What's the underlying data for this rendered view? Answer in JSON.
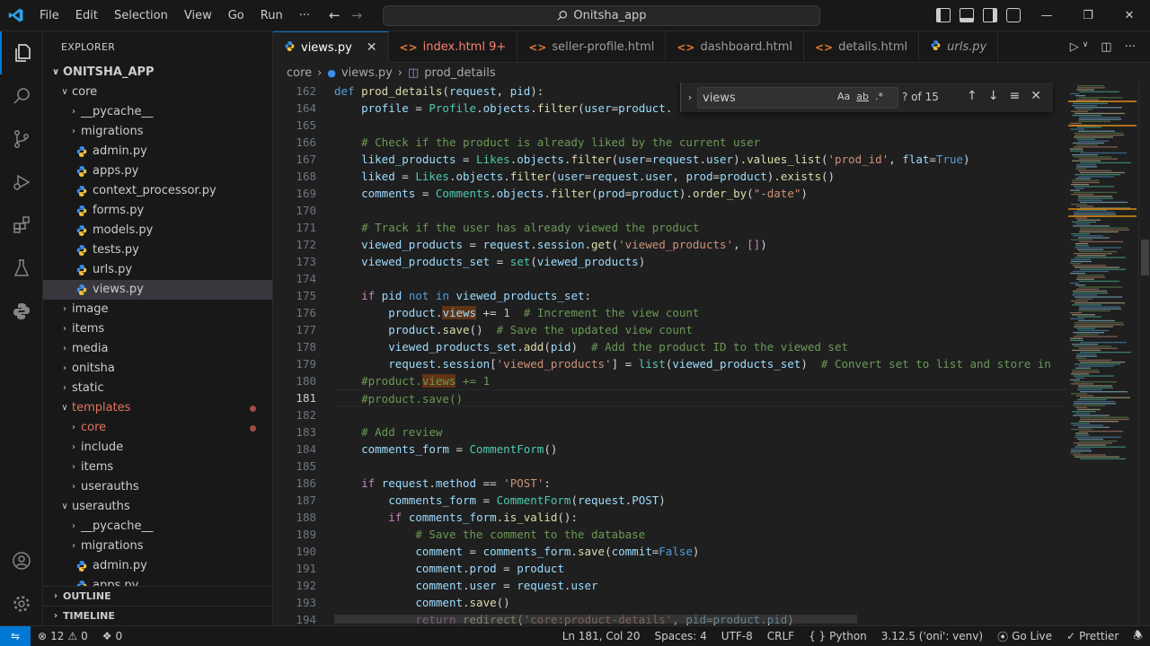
{
  "window": {
    "title": "Onitsha_app",
    "menu": [
      "File",
      "Edit",
      "Selection",
      "View",
      "Go",
      "Run",
      "···"
    ]
  },
  "sidebar": {
    "title": "EXPLORER",
    "root": "ONITSHA_APP",
    "tree": [
      {
        "label": "core",
        "depth": 1,
        "type": "folder-open"
      },
      {
        "label": "__pycache__",
        "depth": 2,
        "type": "folder"
      },
      {
        "label": "migrations",
        "depth": 2,
        "type": "folder"
      },
      {
        "label": "admin.py",
        "depth": 2,
        "type": "file"
      },
      {
        "label": "apps.py",
        "depth": 2,
        "type": "file"
      },
      {
        "label": "context_processor.py",
        "depth": 2,
        "type": "file"
      },
      {
        "label": "forms.py",
        "depth": 2,
        "type": "file"
      },
      {
        "label": "models.py",
        "depth": 2,
        "type": "file"
      },
      {
        "label": "tests.py",
        "depth": 2,
        "type": "file"
      },
      {
        "label": "urls.py",
        "depth": 2,
        "type": "file"
      },
      {
        "label": "views.py",
        "depth": 2,
        "type": "file",
        "selected": true
      },
      {
        "label": "image",
        "depth": 1,
        "type": "folder"
      },
      {
        "label": "items",
        "depth": 1,
        "type": "folder"
      },
      {
        "label": "media",
        "depth": 1,
        "type": "folder"
      },
      {
        "label": "onitsha",
        "depth": 1,
        "type": "folder"
      },
      {
        "label": "static",
        "depth": 1,
        "type": "folder"
      },
      {
        "label": "templates",
        "depth": 1,
        "type": "folder-open",
        "modified": true
      },
      {
        "label": "core",
        "depth": 2,
        "type": "folder",
        "modified": true
      },
      {
        "label": "include",
        "depth": 2,
        "type": "folder"
      },
      {
        "label": "items",
        "depth": 2,
        "type": "folder"
      },
      {
        "label": "userauths",
        "depth": 2,
        "type": "folder"
      },
      {
        "label": "userauths",
        "depth": 1,
        "type": "folder-open"
      },
      {
        "label": "__pycache__",
        "depth": 2,
        "type": "folder"
      },
      {
        "label": "migrations",
        "depth": 2,
        "type": "folder"
      },
      {
        "label": "admin.py",
        "depth": 2,
        "type": "file"
      },
      {
        "label": "apps.py",
        "depth": 2,
        "type": "file"
      }
    ],
    "outline": "OUTLINE",
    "timeline": "TIMELINE"
  },
  "tabs": [
    {
      "label": "views.py",
      "icon": "python",
      "active": true,
      "close": "✕"
    },
    {
      "label": "index.html 9+",
      "icon": "html",
      "error": true
    },
    {
      "label": "seller-profile.html",
      "icon": "html"
    },
    {
      "label": "dashboard.html",
      "icon": "html"
    },
    {
      "label": "details.html",
      "icon": "html"
    },
    {
      "label": "urls.py",
      "icon": "python",
      "italic": true
    }
  ],
  "breadcrumb": [
    "core",
    "views.py",
    "prod_details"
  ],
  "find": {
    "value": "views",
    "match_case": "Aa",
    "whole_word": "ab",
    "regex": ".*",
    "count": "? of 15"
  },
  "editor": {
    "current_line": 181,
    "lines": [
      {
        "n": 162,
        "html": "<span class=\"k\">def</span> <span class=\"fn\">prod_details</span>(<span class=\"vr\">request</span>, <span class=\"vr\">pid</span>):"
      },
      {
        "n": 164,
        "html": "    <span class=\"vr\">profile</span> = <span class=\"cls\">Profile</span>.<span class=\"vr\">objects</span>.<span class=\"fn\">filter</span>(<span class=\"vr\">user</span>=<span class=\"vr\">product</span>."
      },
      {
        "n": 165,
        "html": ""
      },
      {
        "n": 166,
        "html": "    <span class=\"cm\"># Check if the product is already liked by the current user</span>"
      },
      {
        "n": 167,
        "html": "    <span class=\"vr\">liked_products</span> = <span class=\"cls\">Likes</span>.<span class=\"vr\">objects</span>.<span class=\"fn\">filter</span>(<span class=\"vr\">user</span>=<span class=\"vr\">request</span>.<span class=\"vr\">user</span>).<span class=\"fn\">values_list</span>(<span class=\"str\">'prod_id'</span>, <span class=\"vr\">flat</span>=<span class=\"k\">True</span>)"
      },
      {
        "n": 168,
        "html": "    <span class=\"vr\">liked</span> = <span class=\"cls\">Likes</span>.<span class=\"vr\">objects</span>.<span class=\"fn\">filter</span>(<span class=\"vr\">user</span>=<span class=\"vr\">request</span>.<span class=\"vr\">user</span>, <span class=\"vr\">prod</span>=<span class=\"vr\">product</span>).<span class=\"fn\">exists</span>()"
      },
      {
        "n": 169,
        "html": "    <span class=\"vr\">comments</span> = <span class=\"cls\">Comments</span>.<span class=\"vr\">objects</span>.<span class=\"fn\">filter</span>(<span class=\"vr\">prod</span>=<span class=\"vr\">product</span>).<span class=\"fn\">order_by</span>(<span class=\"str\">\"-date\"</span>)"
      },
      {
        "n": 170,
        "html": ""
      },
      {
        "n": 171,
        "html": "    <span class=\"cm\"># Track if the user has already viewed the product</span>"
      },
      {
        "n": 172,
        "html": "    <span class=\"vr\">viewed_products</span> = <span class=\"vr\">request</span>.<span class=\"vr\">session</span>.<span class=\"fn\">get</span>(<span class=\"str\">'viewed_products'</span>, <span class=\"kc\">[]</span>)"
      },
      {
        "n": 173,
        "html": "    <span class=\"vr\">viewed_products_set</span> = <span class=\"cls\">set</span>(<span class=\"vr\">viewed_products</span>)"
      },
      {
        "n": 174,
        "html": ""
      },
      {
        "n": 175,
        "html": "    <span class=\"kc\">if</span> <span class=\"vr\">pid</span> <span class=\"k\">not</span> <span class=\"k\">in</span> <span class=\"vr\">viewed_products_set</span>:"
      },
      {
        "n": 176,
        "html": "        <span class=\"vr\">product</span>.<span class=\"vr hl\">views</span> += <span class=\"num\">1</span>  <span class=\"cm\"># Increment the view count</span>"
      },
      {
        "n": 177,
        "html": "        <span class=\"vr\">product</span>.<span class=\"fn\">save</span>()  <span class=\"cm\"># Save the updated view count</span>"
      },
      {
        "n": 178,
        "html": "        <span class=\"vr\">viewed_products_set</span>.<span class=\"fn\">add</span>(<span class=\"vr\">pid</span>)  <span class=\"cm\"># Add the product ID to the viewed set</span>"
      },
      {
        "n": 179,
        "html": "        <span class=\"vr\">request</span>.<span class=\"vr\">session</span>[<span class=\"str\">'viewed_products'</span>] = <span class=\"cls\">list</span>(<span class=\"vr\">viewed_products_set</span>)  <span class=\"cm\"># Convert set to list and store in</span>"
      },
      {
        "n": 180,
        "html": "    <span class=\"cm\">#product.<span class=\"hl\">views</span> += 1</span>"
      },
      {
        "n": 181,
        "html": "    <span class=\"cm\">#product.save()</span>"
      },
      {
        "n": 182,
        "html": ""
      },
      {
        "n": 183,
        "html": "    <span class=\"cm\"># Add review</span>"
      },
      {
        "n": 184,
        "html": "    <span class=\"vr\">comments_form</span> = <span class=\"cls\">CommentForm</span>()"
      },
      {
        "n": 185,
        "html": ""
      },
      {
        "n": 186,
        "html": "    <span class=\"kc\">if</span> <span class=\"vr\">request</span>.<span class=\"vr\">method</span> == <span class=\"str\">'POST'</span>:"
      },
      {
        "n": 187,
        "html": "        <span class=\"vr\">comments_form</span> = <span class=\"cls\">CommentForm</span>(<span class=\"vr\">request</span>.<span class=\"vr\">POST</span>)"
      },
      {
        "n": 188,
        "html": "        <span class=\"kc\">if</span> <span class=\"vr\">comments_form</span>.<span class=\"fn\">is_valid</span>():"
      },
      {
        "n": 189,
        "html": "            <span class=\"cm\"># Save the comment to the database</span>"
      },
      {
        "n": 190,
        "html": "            <span class=\"vr\">comment</span> = <span class=\"vr\">comments_form</span>.<span class=\"fn\">save</span>(<span class=\"vr\">commit</span>=<span class=\"k\">False</span>)"
      },
      {
        "n": 191,
        "html": "            <span class=\"vr\">comment</span>.<span class=\"vr\">prod</span> = <span class=\"vr\">product</span>"
      },
      {
        "n": 192,
        "html": "            <span class=\"vr\">comment</span>.<span class=\"vr\">user</span> = <span class=\"vr\">request</span>.<span class=\"vr\">user</span>"
      },
      {
        "n": 193,
        "html": "            <span class=\"vr\">comment</span>.<span class=\"fn\">save</span>()"
      },
      {
        "n": 194,
        "html": "            <span class=\"kc\">return</span> <span class=\"fn\">redirect</span>(<span class=\"str\">'core:product-details'</span>, <span class=\"vr\">pid</span>=<span class=\"vr\">product</span>.<span class=\"vr\">pid</span>)"
      }
    ]
  },
  "statusbar": {
    "errors": "12",
    "warnings": "0",
    "ports": "0",
    "position": "Ln 181, Col 20",
    "spaces": "Spaces: 4",
    "encoding": "UTF-8",
    "eol": "CRLF",
    "braces": "{ }",
    "language": "Python",
    "interpreter": "3.12.5 ('oni': venv)",
    "golive": "Go Live",
    "prettier": "Prettier"
  },
  "colors": {
    "accent": "#0078d4",
    "error_tab": "#f88070",
    "modified": "#e2735f"
  }
}
